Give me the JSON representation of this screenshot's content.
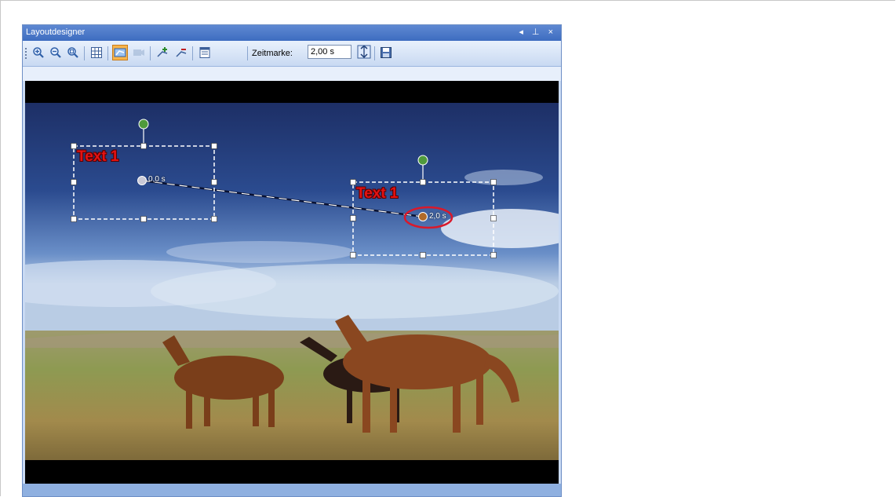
{
  "window": {
    "title": "Layoutdesigner",
    "controls": "◂ ⊥ ×"
  },
  "toolbar": {
    "buttons": [
      {
        "name": "zoom-in-icon"
      },
      {
        "name": "zoom-out-icon"
      },
      {
        "name": "zoom-fit-icon"
      },
      {
        "name": "grid-icon"
      },
      {
        "name": "motion-path-icon",
        "active": true
      },
      {
        "name": "camera-icon",
        "disabled": true
      },
      {
        "name": "add-keyframe-icon"
      },
      {
        "name": "remove-keyframe-icon"
      },
      {
        "name": "properties-icon"
      }
    ],
    "zeitmarke_label": "Zeitmarke:",
    "zeitmarke_value": "2,00 s",
    "apply_icon": "time-apply-icon",
    "save_icon": "save-icon"
  },
  "canvas": {
    "text_objects": [
      {
        "label": "Text 1"
      },
      {
        "label": "Text 1"
      }
    ],
    "keyframes": [
      {
        "time": "0,0 s",
        "color": "#c9c9d6"
      },
      {
        "time": "2,0 s",
        "color": "#b06a2a",
        "highlighted": true
      }
    ],
    "highlight_color": "#d9192b",
    "text_color": "#e41212"
  }
}
